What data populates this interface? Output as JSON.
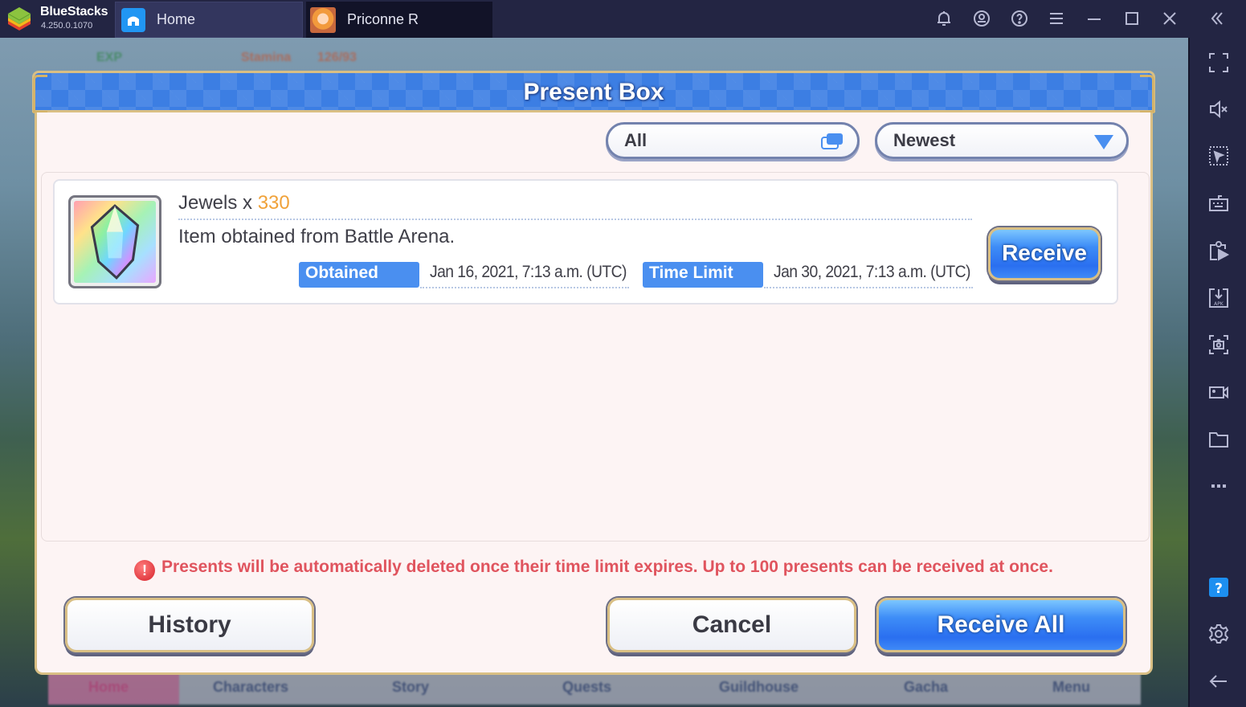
{
  "app": {
    "brand_name": "BlueStacks",
    "version": "4.250.0.1070",
    "tabs": [
      {
        "label": "Home",
        "icon": "home-icon"
      },
      {
        "label": "Priconne R",
        "icon": "game-avatar-icon"
      }
    ],
    "titlebar_icons": [
      "bell-icon",
      "account-icon",
      "help-icon",
      "menu-icon",
      "minimize-icon",
      "maximize-icon",
      "close-icon",
      "collapse-sidebar-icon"
    ],
    "sidebar_icons": [
      "fullscreen-icon",
      "mute-icon",
      "pointer-select-icon",
      "keyboard-icon",
      "media-manager-icon",
      "install-apk-icon",
      "screenshot-icon",
      "record-video-icon",
      "folder-icon",
      "more-icon",
      "help-badge-icon",
      "settings-icon",
      "back-icon"
    ]
  },
  "background_game": {
    "hud": {
      "exp_label": "EXP",
      "stamina_label": "Stamina",
      "stamina_value": "126/93"
    },
    "nav": [
      "Home",
      "Characters",
      "Story",
      "Quests",
      "Guildhouse",
      "Gacha",
      "Menu"
    ]
  },
  "dialog": {
    "title": "Present Box",
    "filter": {
      "selected": "All"
    },
    "sort": {
      "selected": "Newest"
    },
    "presents": [
      {
        "item_name": "Jewels x ",
        "quantity": "330",
        "description": "Item obtained from Battle Arena.",
        "obtained_label": "Obtained",
        "obtained_value": "Jan 16, 2021, 7:13 a.m. (UTC)",
        "time_limit_label": "Time Limit",
        "time_limit_value": "Jan 30, 2021, 7:13 a.m. (UTC)",
        "receive_label": "Receive"
      }
    ],
    "notice": "Presents will be automatically deleted once their time limit expires. Up to 100 presents can be received at once.",
    "notice_icon": "!",
    "buttons": {
      "history": "History",
      "cancel": "Cancel",
      "receive_all": "Receive All"
    }
  },
  "colors": {
    "accent_blue": "#4a8ff0",
    "quantity_orange": "#f0a23a",
    "notice_red": "#e0545e",
    "titlebar_bg": "#232543"
  }
}
